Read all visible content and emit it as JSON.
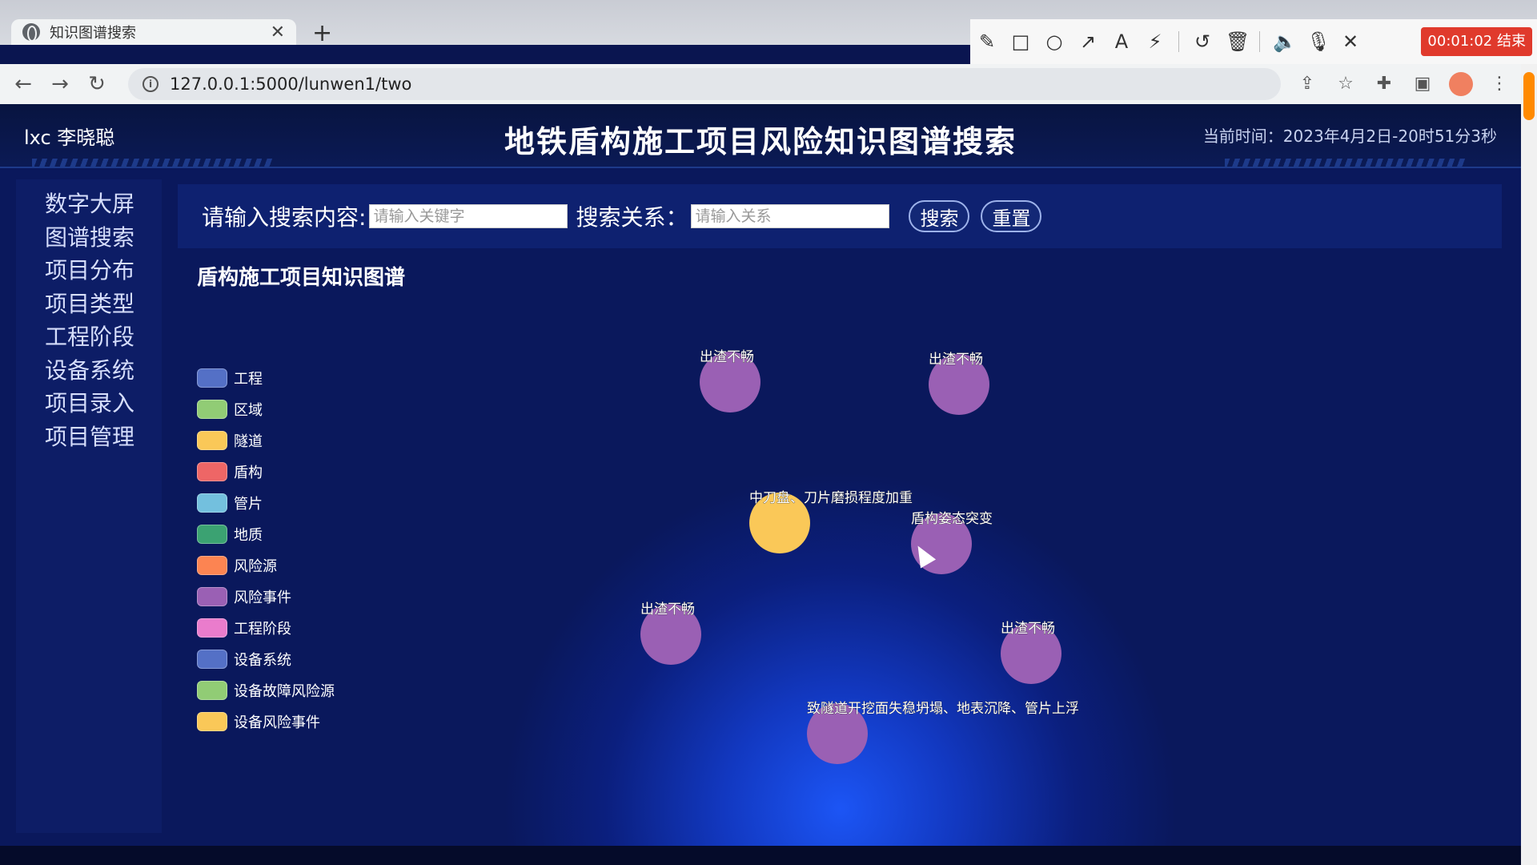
{
  "browser": {
    "tab_title": "知识图谱搜索",
    "tab_close": "✕",
    "new_tab": "+",
    "url": "127.0.0.1:5000/lunwen1/two",
    "recorder_timer": "00:01:02 结束"
  },
  "header": {
    "user": "lxc 李晓聪",
    "title": "地铁盾构施工项目风险知识图谱搜索",
    "time": "当前时间：2023年4月2日-20时51分3秒"
  },
  "sidebar": {
    "items": [
      {
        "label": "数字大屏"
      },
      {
        "label": "图谱搜索"
      },
      {
        "label": "项目分布"
      },
      {
        "label": "项目类型"
      },
      {
        "label": "工程阶段"
      },
      {
        "label": "设备系统"
      },
      {
        "label": "项目录入"
      },
      {
        "label": "项目管理"
      }
    ]
  },
  "search": {
    "content_label": "请输入搜索内容:",
    "content_placeholder": "请输入关键字",
    "relation_label": "搜索关系：",
    "relation_placeholder": "请输入关系",
    "search_button": "搜索",
    "reset_button": "重置"
  },
  "graph": {
    "title": "盾构施工项目知识图谱",
    "legend": [
      {
        "label": "工程",
        "color": "#5470c6"
      },
      {
        "label": "区域",
        "color": "#91cc75"
      },
      {
        "label": "隧道",
        "color": "#fac858"
      },
      {
        "label": "盾构",
        "color": "#ee6666"
      },
      {
        "label": "管片",
        "color": "#73c0de"
      },
      {
        "label": "地质",
        "color": "#3ba272"
      },
      {
        "label": "风险源",
        "color": "#fc8452"
      },
      {
        "label": "风险事件",
        "color": "#9a60b4"
      },
      {
        "label": "工程阶段",
        "color": "#ea7ccc"
      },
      {
        "label": "设备系统",
        "color": "#5470c6"
      },
      {
        "label": "设备故障风险源",
        "color": "#91cc75"
      },
      {
        "label": "设备风险事件",
        "color": "#fac858"
      }
    ],
    "nodes": [
      {
        "label": "出渣不畅",
        "color": "#9a60b4"
      },
      {
        "label": "出渣不畅",
        "color": "#9a60b4"
      },
      {
        "label": "中刀盘、刀片磨损程度加重",
        "color": "#fac858"
      },
      {
        "label": "盾构姿态突变",
        "color": "#9a60b4"
      },
      {
        "label": "出渣不畅",
        "color": "#9a60b4"
      },
      {
        "label": "出渣不畅",
        "color": "#9a60b4"
      },
      {
        "label": "致隧道开挖面失稳坍塌、地表沉降、管片上浮",
        "color": "#9a60b4"
      }
    ]
  }
}
